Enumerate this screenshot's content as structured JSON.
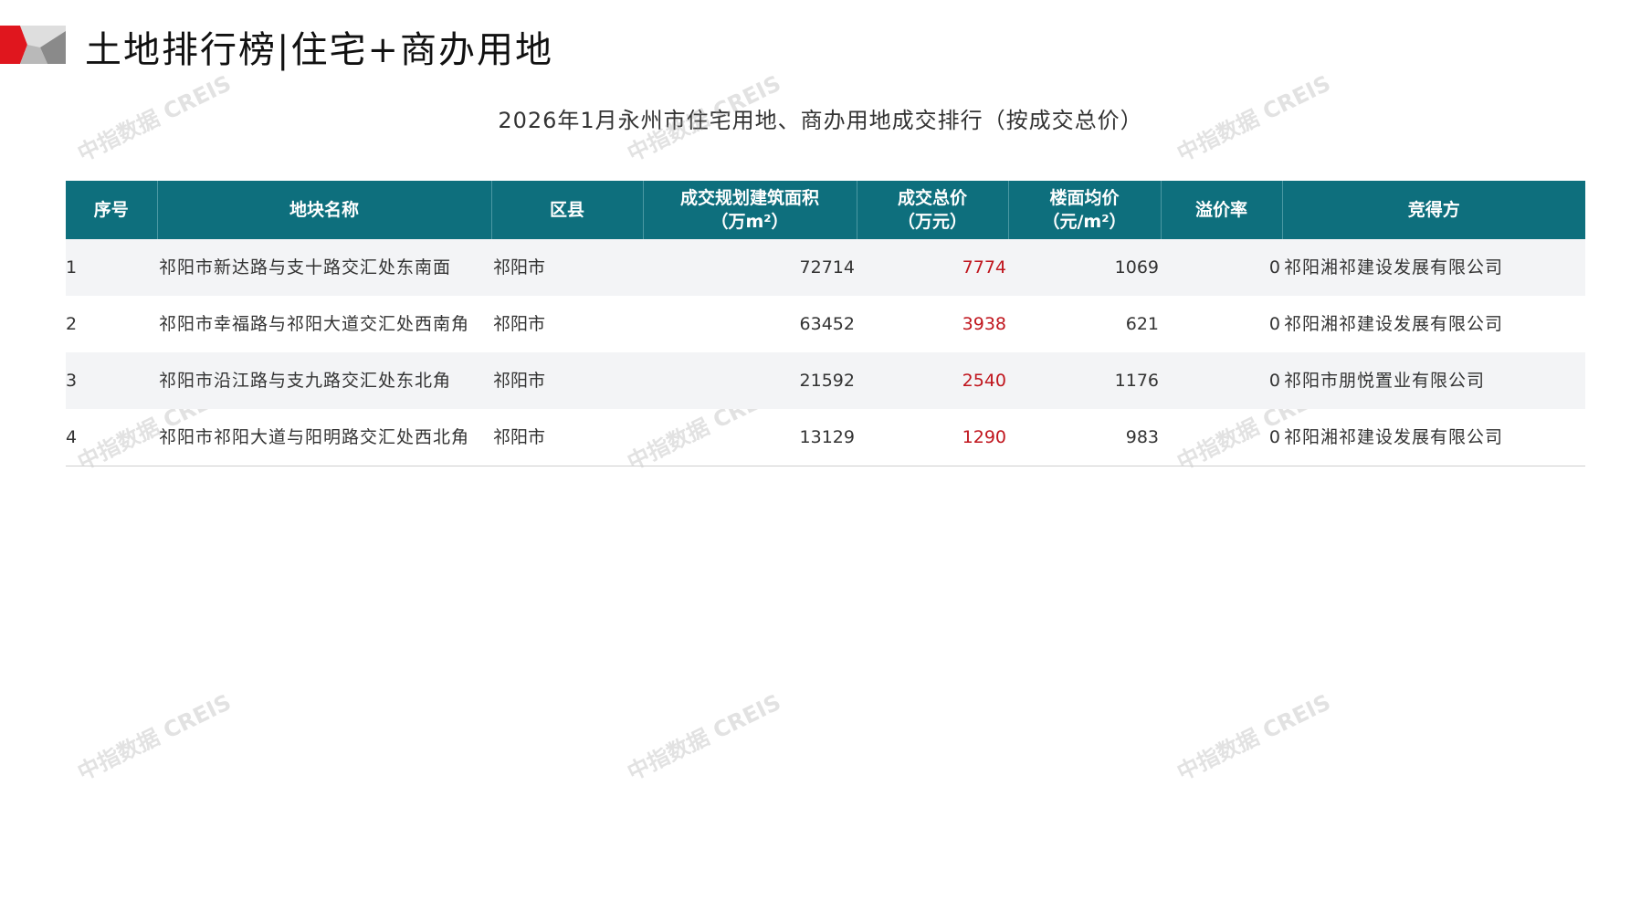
{
  "page_title": "土地排行榜|住宅+商办用地",
  "subtitle": "2026年1月永州市住宅用地、商办用地成交排行（按成交总价）",
  "watermark_text": "中指数据 CREIS",
  "colors": {
    "header_bg": "#0e6f7d",
    "total_price": "#c0151d",
    "logo_red": "#e0161e",
    "logo_grey": "#b9b9b9"
  },
  "table": {
    "headers": [
      {
        "line1": "序号",
        "line2": ""
      },
      {
        "line1": "地块名称",
        "line2": ""
      },
      {
        "line1": "区县",
        "line2": ""
      },
      {
        "line1": "成交规划建筑面积",
        "line2": "（万m²）"
      },
      {
        "line1": "成交总价",
        "line2": "（万元）"
      },
      {
        "line1": "楼面均价",
        "line2": "（元/m²）"
      },
      {
        "line1": "溢价率",
        "line2": ""
      },
      {
        "line1": "竞得方",
        "line2": ""
      }
    ],
    "rows": [
      {
        "index": "1",
        "name": "祁阳市新达路与支十路交汇处东南面",
        "district": "祁阳市",
        "area": "72714",
        "total": "7774",
        "unit_price": "1069",
        "premium": "0",
        "buyer": "祁阳湘祁建设发展有限公司"
      },
      {
        "index": "2",
        "name": "祁阳市幸福路与祁阳大道交汇处西南角",
        "district": "祁阳市",
        "area": "63452",
        "total": "3938",
        "unit_price": "621",
        "premium": "0",
        "buyer": "祁阳湘祁建设发展有限公司"
      },
      {
        "index": "3",
        "name": "祁阳市沿江路与支九路交汇处东北角",
        "district": "祁阳市",
        "area": "21592",
        "total": "2540",
        "unit_price": "1176",
        "premium": "0",
        "buyer": "祁阳市朋悦置业有限公司"
      },
      {
        "index": "4",
        "name": "祁阳市祁阳大道与阳明路交汇处西北角",
        "district": "祁阳市",
        "area": "13129",
        "total": "1290",
        "unit_price": "983",
        "premium": "0",
        "buyer": "祁阳湘祁建设发展有限公司"
      }
    ]
  }
}
